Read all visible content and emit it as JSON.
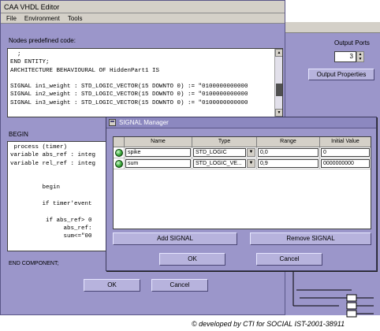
{
  "background_window": {
    "output_ports_label": "Output Ports",
    "output_ports_value": "3",
    "output_properties_label": "Output Properties"
  },
  "editor": {
    "title": "CAA VHDL Editor",
    "menu": [
      "File",
      "Environment",
      "Tools"
    ],
    "nodes_label": "Nodes predefined code:",
    "top_code": "  ;\nEND ENTITY;\nARCHITECTURE BEHAVIOURAL OF HiddenPart1 IS\n\nSIGNAL in1_weight : STD_LOGIC_VECTOR(15 DOWNTO 0) := \"0100000000000\nSIGNAL in2_weight : STD_LOGIC_VECTOR(15 DOWNTO 0) := \"0100000000000\nSIGNAL in3_weight : STD_LOGIC_VECTOR(15 DOWNTO 0) := \"0100000000000",
    "begin_label": "BEGIN",
    "bottom_code": " process (timer)\nvariable abs_ref : integ\nvariable rel_ref : integ\n\n\n         begin\n\n         if timer'event\n\n          if abs_ref> 0\n               abs_ref:\n               sum<=\"00",
    "end_label": "END COMPONENT;",
    "ok_label": "OK",
    "cancel_label": "Cancel"
  },
  "signal_manager": {
    "title": "SIGNAL Manager",
    "columns": [
      "Name",
      "Type",
      "Range",
      "Initial Value"
    ],
    "rows": [
      {
        "name": "spike",
        "type": "STD_LOGIC",
        "range": "0,0",
        "initial": "0"
      },
      {
        "name": "sum",
        "type": "STD_LOGIC_VE...",
        "range": "0,9",
        "initial": "0000000000"
      }
    ],
    "add_label": "Add SIGNAL",
    "remove_label": "Remove SIGNAL",
    "ok_label": "OK",
    "cancel_label": "Cancel"
  },
  "footer_text": "© developed by CTI for SOCIAL IST-2001-38911",
  "colors": {
    "window_bg": "#9b96ca",
    "led": "#3aa63a"
  }
}
